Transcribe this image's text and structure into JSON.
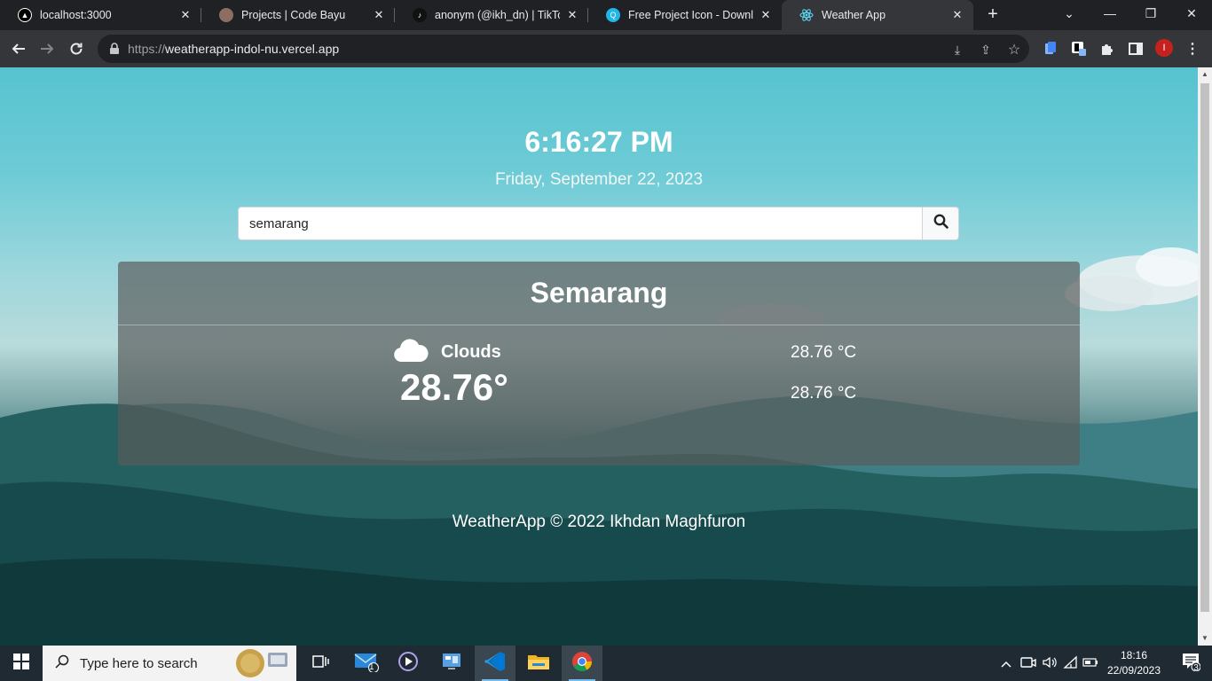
{
  "browser": {
    "tabs": [
      {
        "title": "localhost:3000",
        "active": false
      },
      {
        "title": "Projects | Code Bayu",
        "active": false
      },
      {
        "title": "anonym (@ikh_dn) | TikTok",
        "active": false
      },
      {
        "title": "Free Project Icon - Download",
        "active": false
      },
      {
        "title": "Weather App",
        "active": true
      }
    ],
    "url_scheme": "https://",
    "url_host": "weatherapp-indol-nu.vercel.app",
    "profile_initial": "I"
  },
  "page": {
    "time": "6:16:27 PM",
    "date": "Friday, September 22, 2023",
    "search": {
      "value": "semarang"
    },
    "weather": {
      "city": "Semarang",
      "condition": "Clouds",
      "condition_icon": "cloud-icon",
      "temperature": "28.76°",
      "temp_min": "28.76 °C",
      "temp_max": "28.76 °C"
    },
    "footer": "WeatherApp © 2022 Ikhdan Maghfuron"
  },
  "taskbar": {
    "search_placeholder": "Type here to search",
    "mail_badge": "1",
    "clock_time": "18:16",
    "clock_date": "22/09/2023",
    "notification_count": "3"
  }
}
